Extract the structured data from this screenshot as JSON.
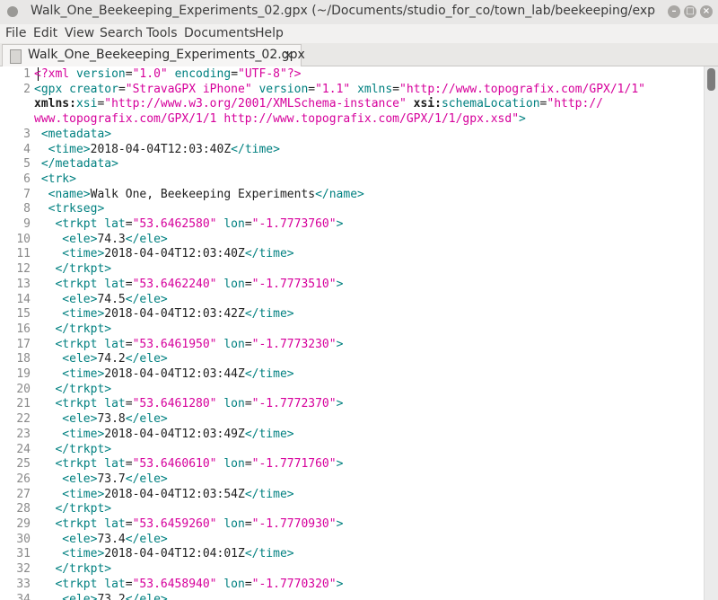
{
  "window": {
    "title": "Walk_One_Beekeeping_Experiments_02.gpx (~/Documents/studio_for_co/town_lab/beekeeping/experiment",
    "buttons": [
      "–",
      "□",
      "×"
    ]
  },
  "menu": [
    "File",
    "Edit",
    "View",
    "Search",
    "Tools",
    "Documents",
    "Help"
  ],
  "tab": {
    "label": "Walk_One_Beekeeping_Experiments_02.gpx",
    "close": "×",
    "icon": "gpx-file-icon"
  },
  "editor": {
    "lines": [
      {
        "n": "1",
        "parts": [
          [
            "pi",
            "<?xml "
          ],
          [
            "attr",
            "version"
          ],
          [
            "txt",
            "="
          ],
          [
            "str",
            "\"1.0\""
          ],
          [
            "txt",
            " "
          ],
          [
            "attr",
            "encoding"
          ],
          [
            "txt",
            "="
          ],
          [
            "str",
            "\"UTF-8\""
          ],
          [
            "pi",
            "?>"
          ]
        ]
      },
      {
        "n": "2",
        "parts": [
          [
            "tp",
            "<gpx "
          ],
          [
            "attr",
            "creator"
          ],
          [
            "txt",
            "="
          ],
          [
            "str",
            "\"StravaGPX iPhone\""
          ],
          [
            "txt",
            " "
          ],
          [
            "attr",
            "version"
          ],
          [
            "txt",
            "="
          ],
          [
            "str",
            "\"1.1\""
          ],
          [
            "txt",
            " "
          ],
          [
            "attr",
            "xmlns"
          ],
          [
            "txt",
            "="
          ],
          [
            "str",
            "\"http://www.topografix.com/GPX/1/1\""
          ]
        ]
      },
      {
        "n": "",
        "parts": [
          [
            "ns",
            "xmlns:"
          ],
          [
            "attr",
            "xsi"
          ],
          [
            "txt",
            "="
          ],
          [
            "str",
            "\"http://www.w3.org/2001/XMLSchema-instance\""
          ],
          [
            "txt",
            " "
          ],
          [
            "ns",
            "xsi:"
          ],
          [
            "attr",
            "schemaLocation"
          ],
          [
            "txt",
            "="
          ],
          [
            "str",
            "\"http://"
          ]
        ]
      },
      {
        "n": "",
        "parts": [
          [
            "str",
            "www.topografix.com/GPX/1/1 http://www.topografix.com/GPX/1/1/gpx.xsd\""
          ],
          [
            "tp",
            ">"
          ]
        ]
      },
      {
        "n": "3",
        "parts": [
          [
            "tp",
            " <metadata>"
          ]
        ]
      },
      {
        "n": "4",
        "parts": [
          [
            "tp",
            "  <time>"
          ],
          [
            "txt",
            "2018-04-04T12:03:40Z"
          ],
          [
            "tp",
            "</time>"
          ]
        ]
      },
      {
        "n": "5",
        "parts": [
          [
            "tp",
            " </metadata>"
          ]
        ]
      },
      {
        "n": "6",
        "parts": [
          [
            "tp",
            " <trk>"
          ]
        ]
      },
      {
        "n": "7",
        "parts": [
          [
            "tp",
            "  <name>"
          ],
          [
            "txt",
            "Walk One, Beekeeping Experiments"
          ],
          [
            "tp",
            "</name>"
          ]
        ]
      },
      {
        "n": "8",
        "parts": [
          [
            "tp",
            "  <trkseg>"
          ]
        ]
      },
      {
        "n": "9",
        "parts": [
          [
            "tp",
            "   <trkpt "
          ],
          [
            "attr",
            "lat"
          ],
          [
            "txt",
            "="
          ],
          [
            "str",
            "\"53.6462580\""
          ],
          [
            "txt",
            " "
          ],
          [
            "attr",
            "lon"
          ],
          [
            "txt",
            "="
          ],
          [
            "str",
            "\"-1.7773760\""
          ],
          [
            "tp",
            ">"
          ]
        ]
      },
      {
        "n": "10",
        "parts": [
          [
            "tp",
            "    <ele>"
          ],
          [
            "txt",
            "74.3"
          ],
          [
            "tp",
            "</ele>"
          ]
        ]
      },
      {
        "n": "11",
        "parts": [
          [
            "tp",
            "    <time>"
          ],
          [
            "txt",
            "2018-04-04T12:03:40Z"
          ],
          [
            "tp",
            "</time>"
          ]
        ]
      },
      {
        "n": "12",
        "parts": [
          [
            "tp",
            "   </trkpt>"
          ]
        ]
      },
      {
        "n": "13",
        "parts": [
          [
            "tp",
            "   <trkpt "
          ],
          [
            "attr",
            "lat"
          ],
          [
            "txt",
            "="
          ],
          [
            "str",
            "\"53.6462240\""
          ],
          [
            "txt",
            " "
          ],
          [
            "attr",
            "lon"
          ],
          [
            "txt",
            "="
          ],
          [
            "str",
            "\"-1.7773510\""
          ],
          [
            "tp",
            ">"
          ]
        ]
      },
      {
        "n": "14",
        "parts": [
          [
            "tp",
            "    <ele>"
          ],
          [
            "txt",
            "74.5"
          ],
          [
            "tp",
            "</ele>"
          ]
        ]
      },
      {
        "n": "15",
        "parts": [
          [
            "tp",
            "    <time>"
          ],
          [
            "txt",
            "2018-04-04T12:03:42Z"
          ],
          [
            "tp",
            "</time>"
          ]
        ]
      },
      {
        "n": "16",
        "parts": [
          [
            "tp",
            "   </trkpt>"
          ]
        ]
      },
      {
        "n": "17",
        "parts": [
          [
            "tp",
            "   <trkpt "
          ],
          [
            "attr",
            "lat"
          ],
          [
            "txt",
            "="
          ],
          [
            "str",
            "\"53.6461950\""
          ],
          [
            "txt",
            " "
          ],
          [
            "attr",
            "lon"
          ],
          [
            "txt",
            "="
          ],
          [
            "str",
            "\"-1.7773230\""
          ],
          [
            "tp",
            ">"
          ]
        ]
      },
      {
        "n": "18",
        "parts": [
          [
            "tp",
            "    <ele>"
          ],
          [
            "txt",
            "74.2"
          ],
          [
            "tp",
            "</ele>"
          ]
        ]
      },
      {
        "n": "19",
        "parts": [
          [
            "tp",
            "    <time>"
          ],
          [
            "txt",
            "2018-04-04T12:03:44Z"
          ],
          [
            "tp",
            "</time>"
          ]
        ]
      },
      {
        "n": "20",
        "parts": [
          [
            "tp",
            "   </trkpt>"
          ]
        ]
      },
      {
        "n": "21",
        "parts": [
          [
            "tp",
            "   <trkpt "
          ],
          [
            "attr",
            "lat"
          ],
          [
            "txt",
            "="
          ],
          [
            "str",
            "\"53.6461280\""
          ],
          [
            "txt",
            " "
          ],
          [
            "attr",
            "lon"
          ],
          [
            "txt",
            "="
          ],
          [
            "str",
            "\"-1.7772370\""
          ],
          [
            "tp",
            ">"
          ]
        ]
      },
      {
        "n": "22",
        "parts": [
          [
            "tp",
            "    <ele>"
          ],
          [
            "txt",
            "73.8"
          ],
          [
            "tp",
            "</ele>"
          ]
        ]
      },
      {
        "n": "23",
        "parts": [
          [
            "tp",
            "    <time>"
          ],
          [
            "txt",
            "2018-04-04T12:03:49Z"
          ],
          [
            "tp",
            "</time>"
          ]
        ]
      },
      {
        "n": "24",
        "parts": [
          [
            "tp",
            "   </trkpt>"
          ]
        ]
      },
      {
        "n": "25",
        "parts": [
          [
            "tp",
            "   <trkpt "
          ],
          [
            "attr",
            "lat"
          ],
          [
            "txt",
            "="
          ],
          [
            "str",
            "\"53.6460610\""
          ],
          [
            "txt",
            " "
          ],
          [
            "attr",
            "lon"
          ],
          [
            "txt",
            "="
          ],
          [
            "str",
            "\"-1.7771760\""
          ],
          [
            "tp",
            ">"
          ]
        ]
      },
      {
        "n": "26",
        "parts": [
          [
            "tp",
            "    <ele>"
          ],
          [
            "txt",
            "73.7"
          ],
          [
            "tp",
            "</ele>"
          ]
        ]
      },
      {
        "n": "27",
        "parts": [
          [
            "tp",
            "    <time>"
          ],
          [
            "txt",
            "2018-04-04T12:03:54Z"
          ],
          [
            "tp",
            "</time>"
          ]
        ]
      },
      {
        "n": "28",
        "parts": [
          [
            "tp",
            "   </trkpt>"
          ]
        ]
      },
      {
        "n": "29",
        "parts": [
          [
            "tp",
            "   <trkpt "
          ],
          [
            "attr",
            "lat"
          ],
          [
            "txt",
            "="
          ],
          [
            "str",
            "\"53.6459260\""
          ],
          [
            "txt",
            " "
          ],
          [
            "attr",
            "lon"
          ],
          [
            "txt",
            "="
          ],
          [
            "str",
            "\"-1.7770930\""
          ],
          [
            "tp",
            ">"
          ]
        ]
      },
      {
        "n": "30",
        "parts": [
          [
            "tp",
            "    <ele>"
          ],
          [
            "txt",
            "73.4"
          ],
          [
            "tp",
            "</ele>"
          ]
        ]
      },
      {
        "n": "31",
        "parts": [
          [
            "tp",
            "    <time>"
          ],
          [
            "txt",
            "2018-04-04T12:04:01Z"
          ],
          [
            "tp",
            "</time>"
          ]
        ]
      },
      {
        "n": "32",
        "parts": [
          [
            "tp",
            "   </trkpt>"
          ]
        ]
      },
      {
        "n": "33",
        "parts": [
          [
            "tp",
            "   <trkpt "
          ],
          [
            "attr",
            "lat"
          ],
          [
            "txt",
            "="
          ],
          [
            "str",
            "\"53.6458940\""
          ],
          [
            "txt",
            " "
          ],
          [
            "attr",
            "lon"
          ],
          [
            "txt",
            "="
          ],
          [
            "str",
            "\"-1.7770320\""
          ],
          [
            "tp",
            ">"
          ]
        ]
      },
      {
        "n": "34",
        "parts": [
          [
            "tp",
            "    <ele>"
          ],
          [
            "txt",
            "73.2"
          ],
          [
            "tp",
            "</ele>"
          ]
        ]
      }
    ]
  },
  "colors": {
    "tag": "#008080",
    "string": "#d6009b",
    "background": "#ffffff",
    "line_number": "#8a8a8a"
  }
}
